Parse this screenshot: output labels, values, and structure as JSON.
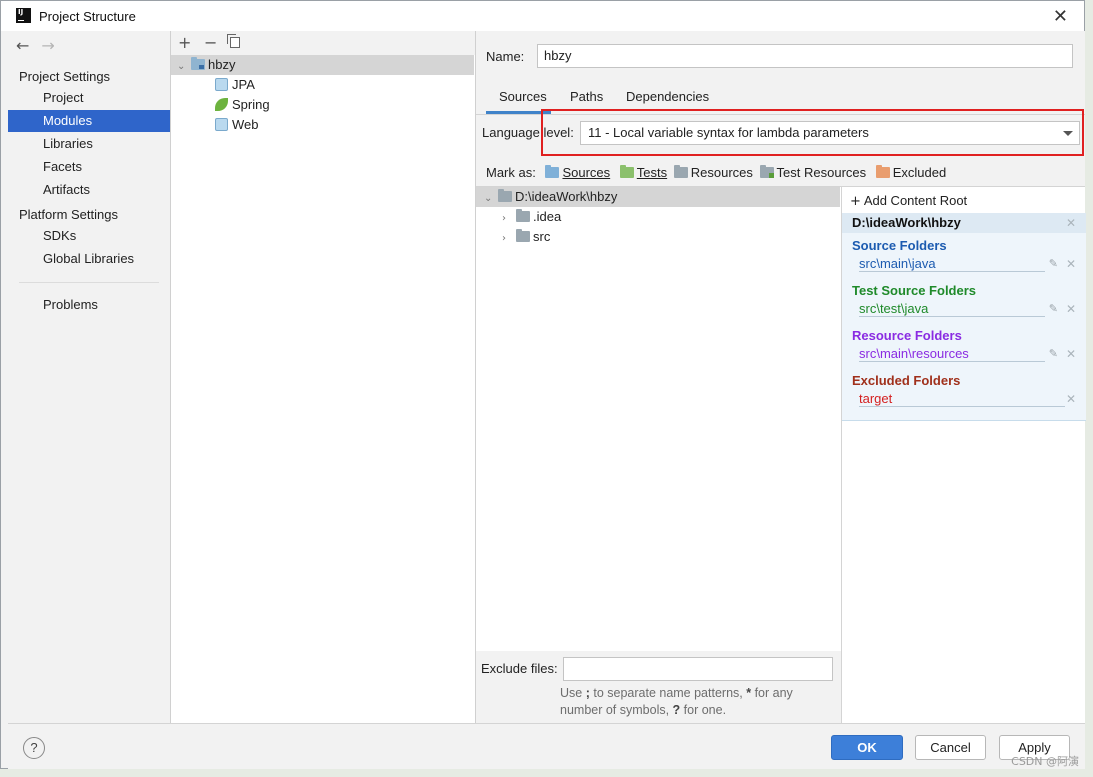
{
  "window": {
    "title": "Project Structure"
  },
  "nav": {
    "project_settings_label": "Project Settings",
    "project_items": [
      "Project",
      "Modules",
      "Libraries",
      "Facets",
      "Artifacts"
    ],
    "platform_settings_label": "Platform Settings",
    "platform_items": [
      "SDKs",
      "Global Libraries"
    ],
    "problems_label": "Problems",
    "selected": "Modules"
  },
  "module_tree": {
    "module": "hbzy",
    "facets": [
      "JPA",
      "Spring",
      "Web"
    ]
  },
  "module": {
    "name_label": "Name:",
    "name_value": "hbzy",
    "tabs": [
      "Sources",
      "Paths",
      "Dependencies"
    ],
    "active_tab": "Sources",
    "language_level_label": "Language level:",
    "language_level_value": "11 - Local variable syntax for lambda parameters",
    "mark_as_label": "Mark as:",
    "mark_as": [
      "Sources",
      "Tests",
      "Resources",
      "Test Resources",
      "Excluded"
    ]
  },
  "source_tree": {
    "root": "D:\\ideaWork\\hbzy",
    "children": [
      ".idea",
      "src"
    ]
  },
  "content_root": {
    "add_label": "Add Content Root",
    "path": "D:\\ideaWork\\hbzy",
    "sections": [
      {
        "title": "Source Folders",
        "entry": "src\\main\\java",
        "color": "#1c5bb0"
      },
      {
        "title": "Test Source Folders",
        "entry": "src\\test\\java",
        "color": "#1f8a2a"
      },
      {
        "title": "Resource Folders",
        "entry": "src\\main\\resources",
        "color": "#8a2be2"
      },
      {
        "title": "Excluded Folders",
        "entry": "target",
        "color": "#a0301b",
        "entry_color": "#d42020"
      }
    ]
  },
  "exclude_files": {
    "label": "Exclude files:",
    "hint_1": "Use ",
    "hint_semicolon": ";",
    "hint_2": " to separate name patterns, ",
    "hint_star": "*",
    "hint_3": " for any number of symbols, ",
    "hint_q": "?",
    "hint_4": " for one."
  },
  "buttons": {
    "help": "?",
    "ok": "OK",
    "cancel": "Cancel",
    "apply": "Apply"
  },
  "watermark": "CSDN @阿演",
  "colors": {
    "accent": "#2f65ca",
    "highlight_box": "#e02020"
  }
}
